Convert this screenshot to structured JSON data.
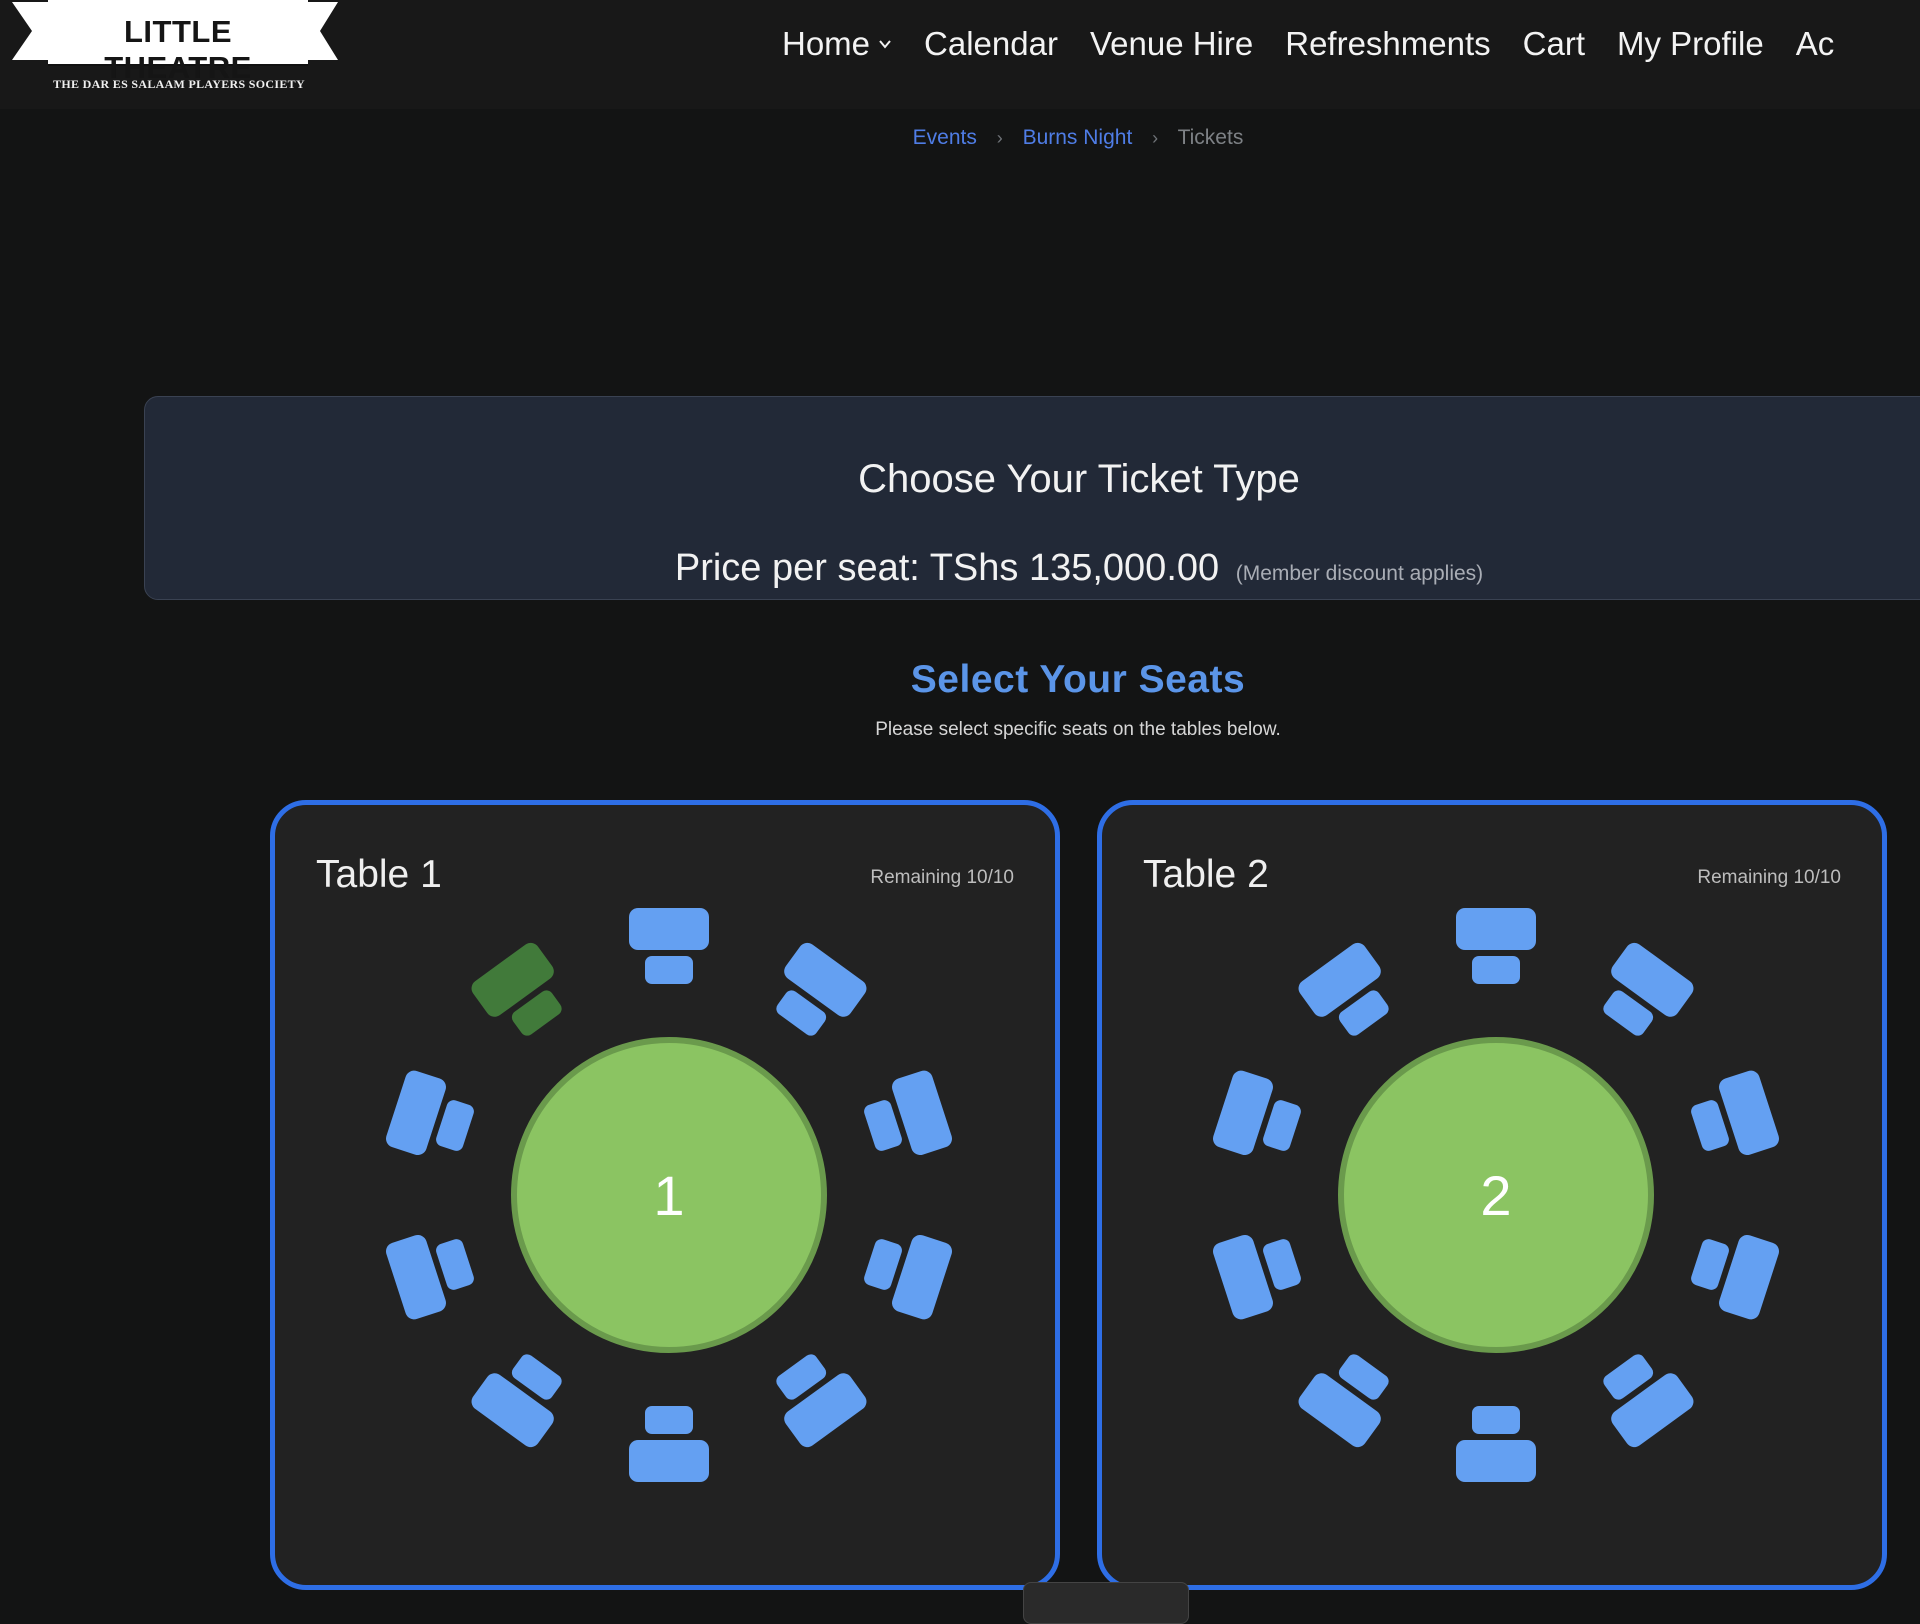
{
  "header": {
    "logo_title": "LITTLE THEATRE",
    "logo_subtitle": "THE DAR ES SALAAM PLAYERS SOCIETY",
    "nav": {
      "home": "Home",
      "calendar": "Calendar",
      "venue_hire": "Venue Hire",
      "refreshments": "Refreshments",
      "cart": "Cart",
      "my_profile": "My Profile",
      "more": "Ac"
    }
  },
  "breadcrumb": {
    "events": "Events",
    "event": "Burns Night",
    "current": "Tickets"
  },
  "ticket": {
    "title": "Choose Your Ticket Type",
    "price": "Price per seat: TShs 135,000.00",
    "note": "(Member discount applies)"
  },
  "seats": {
    "title": "Select Your Seats",
    "subtitle": "Please select specific seats on the tables below."
  },
  "tables": [
    {
      "name": "Table 1",
      "remaining": "Remaining 10/10",
      "number": "1",
      "highlighted_seat": 9
    },
    {
      "name": "Table 2",
      "remaining": "Remaining 10/10",
      "number": "2",
      "highlighted_seat": -1
    }
  ],
  "colors": {
    "seat_available": "#64a0f2",
    "seat_highlight": "#417a3a",
    "table_fill": "#8bc462",
    "table_ring": "#6a9a4c",
    "card_border": "#2e6ee6"
  }
}
